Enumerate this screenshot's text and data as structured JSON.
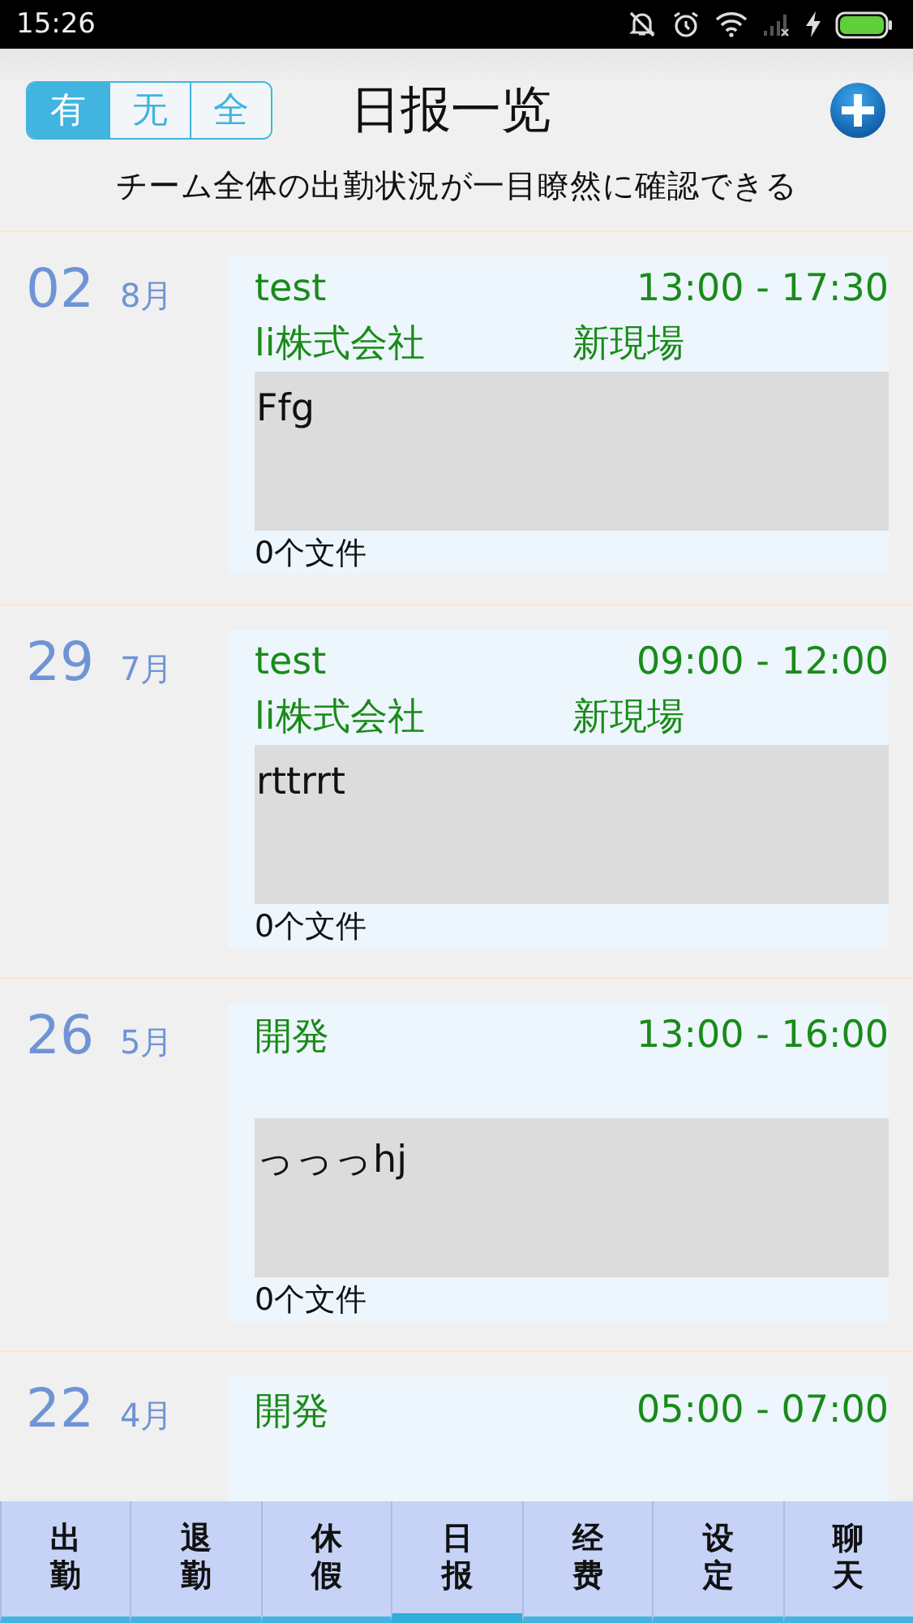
{
  "status_bar": {
    "time": "15:26"
  },
  "header": {
    "filters": [
      {
        "label": "有",
        "selected": true
      },
      {
        "label": "无",
        "selected": false
      },
      {
        "label": "全",
        "selected": false
      }
    ],
    "title": "日报一览"
  },
  "subtitle": "チーム全体の出勤状況が一目瞭然に確認できる",
  "reports": [
    {
      "day": "02",
      "month": "8月",
      "title": "test",
      "time": "13:00 - 17:30",
      "company": "li株式会社",
      "site": "新現場",
      "content": "Ffg",
      "files": "0个文件"
    },
    {
      "day": "29",
      "month": "7月",
      "title": "test",
      "time": "09:00 - 12:00",
      "company": "li株式会社",
      "site": "新現場",
      "content": "rttrrt",
      "files": "0个文件"
    },
    {
      "day": "26",
      "month": "5月",
      "title": "開発",
      "time": "13:00 - 16:00",
      "content": "っっっhj",
      "files": "0个文件"
    },
    {
      "day": "22",
      "month": "4月",
      "title": "開発",
      "time": "05:00 - 07:00"
    }
  ],
  "tabs": [
    {
      "label": "出勤",
      "selected": false
    },
    {
      "label": "退勤",
      "selected": false
    },
    {
      "label": "休假",
      "selected": false
    },
    {
      "label": "日报",
      "selected": true
    },
    {
      "label": "经费",
      "selected": false
    },
    {
      "label": "设定",
      "selected": false
    },
    {
      "label": "聊天",
      "selected": false
    }
  ]
}
